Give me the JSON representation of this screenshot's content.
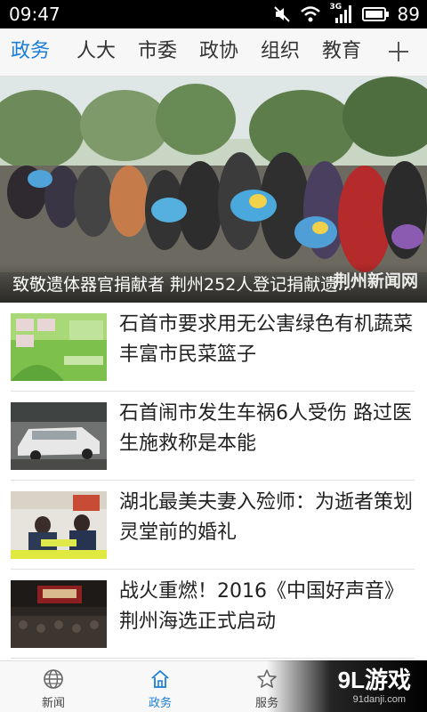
{
  "status_bar": {
    "time": "09:47",
    "network": "3G",
    "battery": "89"
  },
  "tabs": [
    {
      "label": "政务",
      "active": true
    },
    {
      "label": "人大",
      "active": false
    },
    {
      "label": "市委",
      "active": false
    },
    {
      "label": "政协",
      "active": false
    },
    {
      "label": "组织",
      "active": false
    },
    {
      "label": "教育",
      "active": false
    }
  ],
  "hero": {
    "caption": "致敬遗体器官捐献者 荆州252人登记捐献遗...",
    "watermark": "荆州新闻网"
  },
  "news": [
    {
      "title": "石首市要求用无公害绿色有机蔬菜丰富市民菜篮子"
    },
    {
      "title": "石首闹市发生车祸6人受伤 路过医生施救称是本能"
    },
    {
      "title": "湖北最美夫妻入殓师：为逝者策划灵堂前的婚礼"
    },
    {
      "title": "战火重燃！2016《中国好声音》荆州海选正式启动"
    }
  ],
  "bottom_nav": [
    {
      "label": "新闻",
      "icon": "globe-icon",
      "active": false
    },
    {
      "label": "政务",
      "icon": "home-icon",
      "active": true
    },
    {
      "label": "服务",
      "icon": "star-icon",
      "active": false
    }
  ],
  "corner_logo": {
    "brand": "9L游戏",
    "site": "91danji.com"
  },
  "colors": {
    "accent": "#1a7dd7",
    "text": "#222222",
    "divider": "#e0e0e0"
  }
}
